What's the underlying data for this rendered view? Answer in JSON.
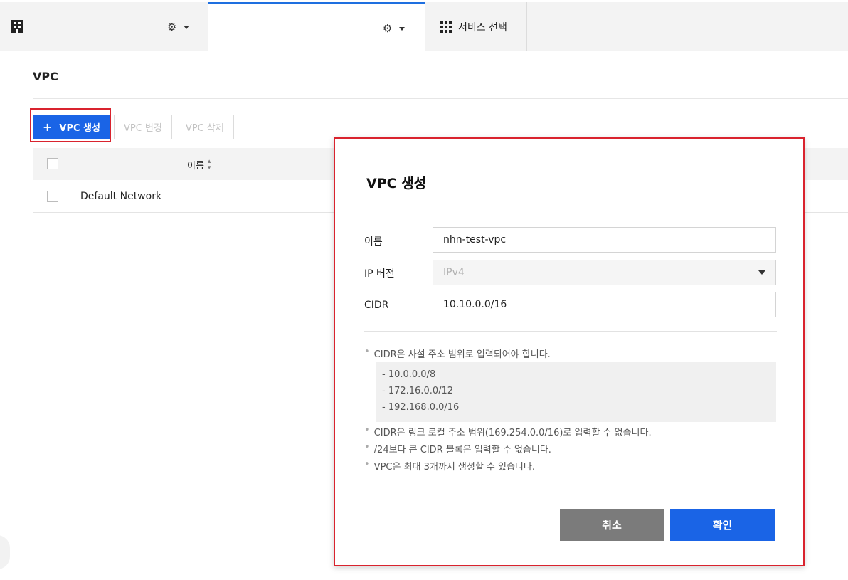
{
  "topbar": {
    "service_select_label": "서비스 선택"
  },
  "page": {
    "title": "VPC"
  },
  "toolbar": {
    "create_label": "VPC 생성",
    "create_plus": "+",
    "edit_label": "VPC 변경",
    "delete_label": "VPC 삭제"
  },
  "table": {
    "columns": [
      "이름"
    ],
    "sort_glyph": "▲▼",
    "rows": [
      {
        "name": "Default Network"
      }
    ]
  },
  "modal": {
    "title": "VPC 생성",
    "fields": {
      "name_label": "이름",
      "name_value": "nhn-test-vpc",
      "ip_version_label": "IP 버전",
      "ip_version_value": "IPv4",
      "cidr_label": "CIDR",
      "cidr_value": "10.10.0.0/16"
    },
    "notes": {
      "note1": "CIDR은 사설 주소 범위로 입력되어야 합니다.",
      "ranges": [
        "- 10.0.0.0/8",
        "- 172.16.0.0/12",
        "- 192.168.0.0/16"
      ],
      "note2": "CIDR은 링크 로컬 주소 범위(169.254.0.0/16)로 입력할 수 없습니다.",
      "note3": "/24보다 큰 CIDR 블록은 입력할 수 없습니다.",
      "note4": "VPC은 최대 3개까지 생성할 수 있습니다.",
      "bullet": "•"
    },
    "cancel_label": "취소",
    "confirm_label": "확인"
  },
  "colors": {
    "primary": "#1a64e6",
    "highlight": "#d9232e",
    "cancel": "#7b7b7b"
  }
}
